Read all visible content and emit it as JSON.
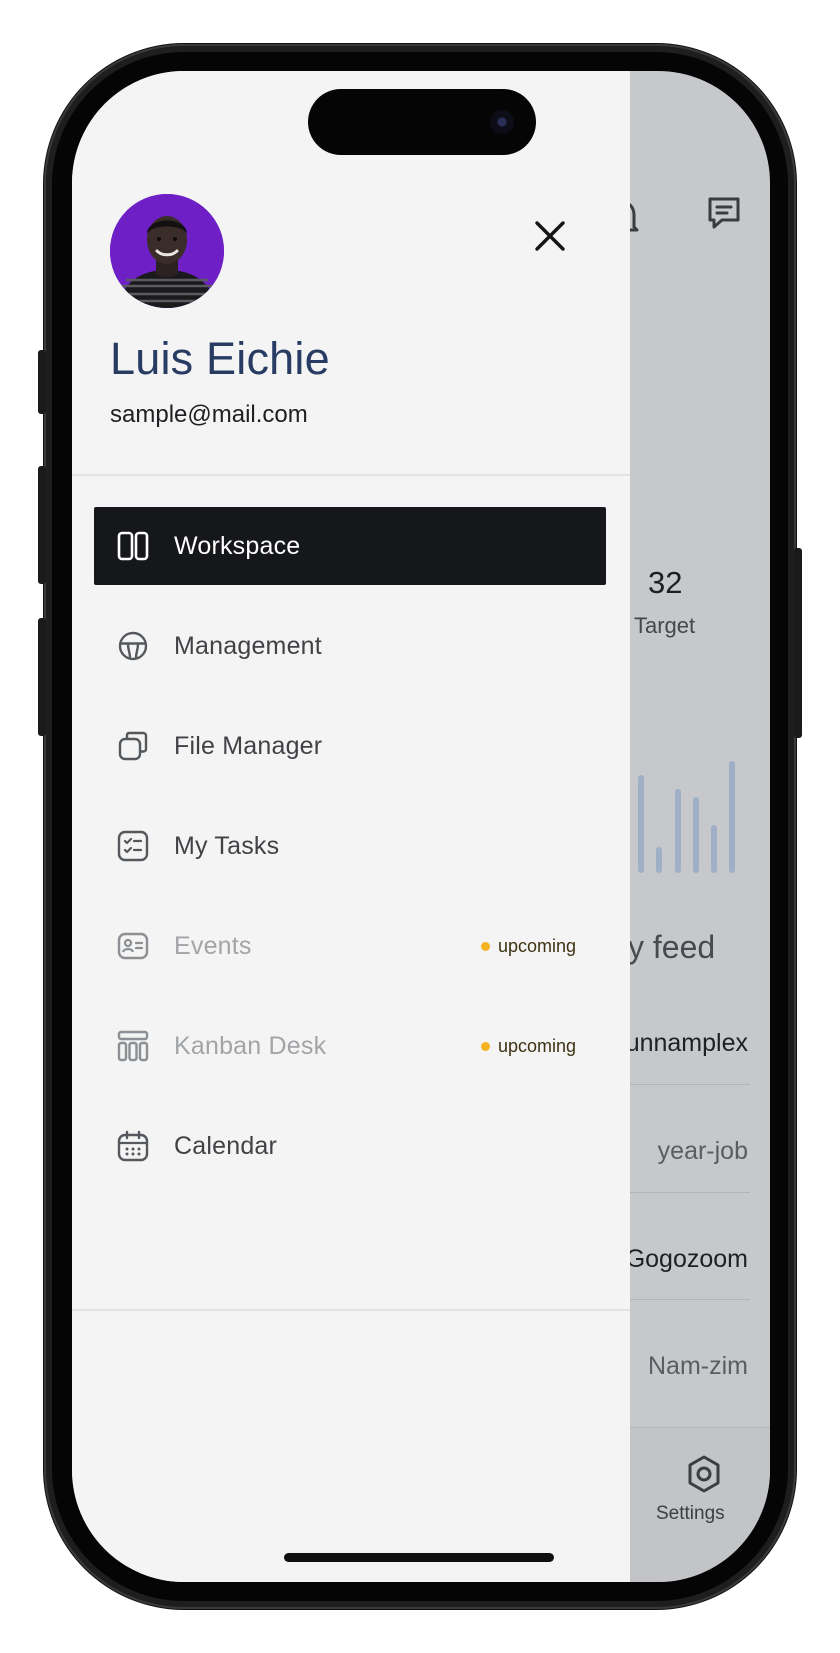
{
  "user": {
    "name": "Luis Eichie",
    "email": "sample@mail.com"
  },
  "nav": {
    "items": [
      {
        "label": "Workspace",
        "icon": "workspace-icon",
        "active": true
      },
      {
        "label": "Management",
        "icon": "steering-wheel-icon",
        "active": false
      },
      {
        "label": "File Manager",
        "icon": "file-icon",
        "active": false
      },
      {
        "label": "My Tasks",
        "icon": "checklist-icon",
        "active": false
      },
      {
        "label": "Events",
        "icon": "id-card-icon",
        "active": false,
        "badge": "upcoming"
      },
      {
        "label": "Kanban Desk",
        "icon": "kanban-icon",
        "active": false,
        "badge": "upcoming"
      },
      {
        "label": "Calendar",
        "icon": "calendar-icon",
        "active": false
      }
    ]
  },
  "background": {
    "target_count": "32",
    "target_label": "Target",
    "feed_title_fragment": "ity feed",
    "feed_rows": [
      "unnamplex",
      "year-job",
      "Gogozoom",
      "Nam-zim"
    ],
    "tab_settings_label": "Settings"
  },
  "colors": {
    "accent_dark": "#16171a",
    "name_color": "#273b63",
    "avatar_bg": "#6e20c6",
    "badge_dot": "#f5b321",
    "drawer_bg": "#f3f4f3"
  }
}
